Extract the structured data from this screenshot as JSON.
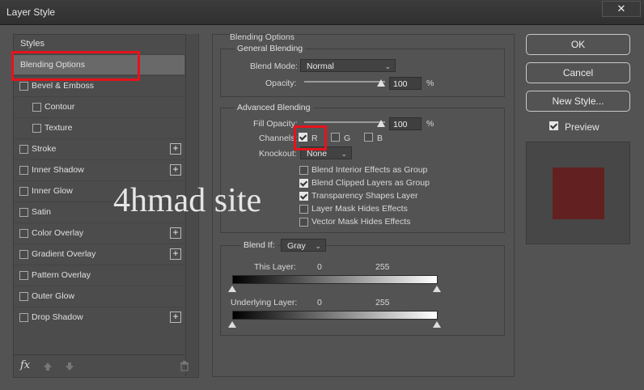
{
  "window": {
    "title": "Layer Style",
    "close_glyph": "✕"
  },
  "left_panel": {
    "header": "Styles",
    "items": [
      {
        "label": "Blending Options",
        "selected": true
      },
      {
        "label": "Bevel & Emboss",
        "checkbox": true
      },
      {
        "label": "Contour",
        "checkbox": true,
        "indent": true
      },
      {
        "label": "Texture",
        "checkbox": true,
        "indent": true
      },
      {
        "label": "Stroke",
        "checkbox": true,
        "plus": true
      },
      {
        "label": "Inner Shadow",
        "checkbox": true,
        "plus": true
      },
      {
        "label": "Inner Glow",
        "checkbox": true
      },
      {
        "label": "Satin",
        "checkbox": true
      },
      {
        "label": "Color Overlay",
        "checkbox": true,
        "plus": true
      },
      {
        "label": "Gradient Overlay",
        "checkbox": true,
        "plus": true
      },
      {
        "label": "Pattern Overlay",
        "checkbox": true
      },
      {
        "label": "Outer Glow",
        "checkbox": true
      },
      {
        "label": "Drop Shadow",
        "checkbox": true,
        "plus": true
      }
    ],
    "plus_glyph": "+",
    "footer": {
      "fx": "fx",
      "up_icon": "arrow-up-icon",
      "down_icon": "arrow-down-icon",
      "trash_icon": "trash-icon"
    }
  },
  "blending": {
    "section_title": "Blending Options",
    "general": {
      "title": "General Blending",
      "blend_mode_label": "Blend Mode:",
      "blend_mode_value": "Normal",
      "opacity_label": "Opacity:",
      "opacity_value": "100",
      "opacity_unit": "%"
    },
    "advanced": {
      "title": "Advanced Blending",
      "fill_opacity_label": "Fill Opacity:",
      "fill_opacity_value": "100",
      "fill_unit": "%",
      "channels_label": "Channels:",
      "channels": [
        {
          "label": "R",
          "checked": true
        },
        {
          "label": "G",
          "checked": false
        },
        {
          "label": "B",
          "checked": false
        }
      ],
      "knockout_label": "Knockout:",
      "knockout_value": "None",
      "options": [
        {
          "label": "Blend Interior Effects as Group",
          "checked": false
        },
        {
          "label": "Blend Clipped Layers as Group",
          "checked": true
        },
        {
          "label": "Transparency Shapes Layer",
          "checked": true
        },
        {
          "label": "Layer Mask Hides Effects",
          "checked": false
        },
        {
          "label": "Vector Mask Hides Effects",
          "checked": false
        }
      ]
    },
    "blend_if": {
      "label": "Blend If:",
      "value": "Gray",
      "this_layer_label": "This Layer:",
      "this_layer_low": "0",
      "this_layer_high": "255",
      "underlying_label": "Underlying Layer:",
      "underlying_low": "0",
      "underlying_high": "255"
    }
  },
  "buttons": {
    "ok": "OK",
    "cancel": "Cancel",
    "new_style": "New Style..."
  },
  "preview": {
    "label": "Preview",
    "checked": true,
    "swatch_color": "#622020"
  },
  "watermark": "4hmad site",
  "colors": {
    "highlight": "#e5131c",
    "dialog_bg": "#535353"
  }
}
